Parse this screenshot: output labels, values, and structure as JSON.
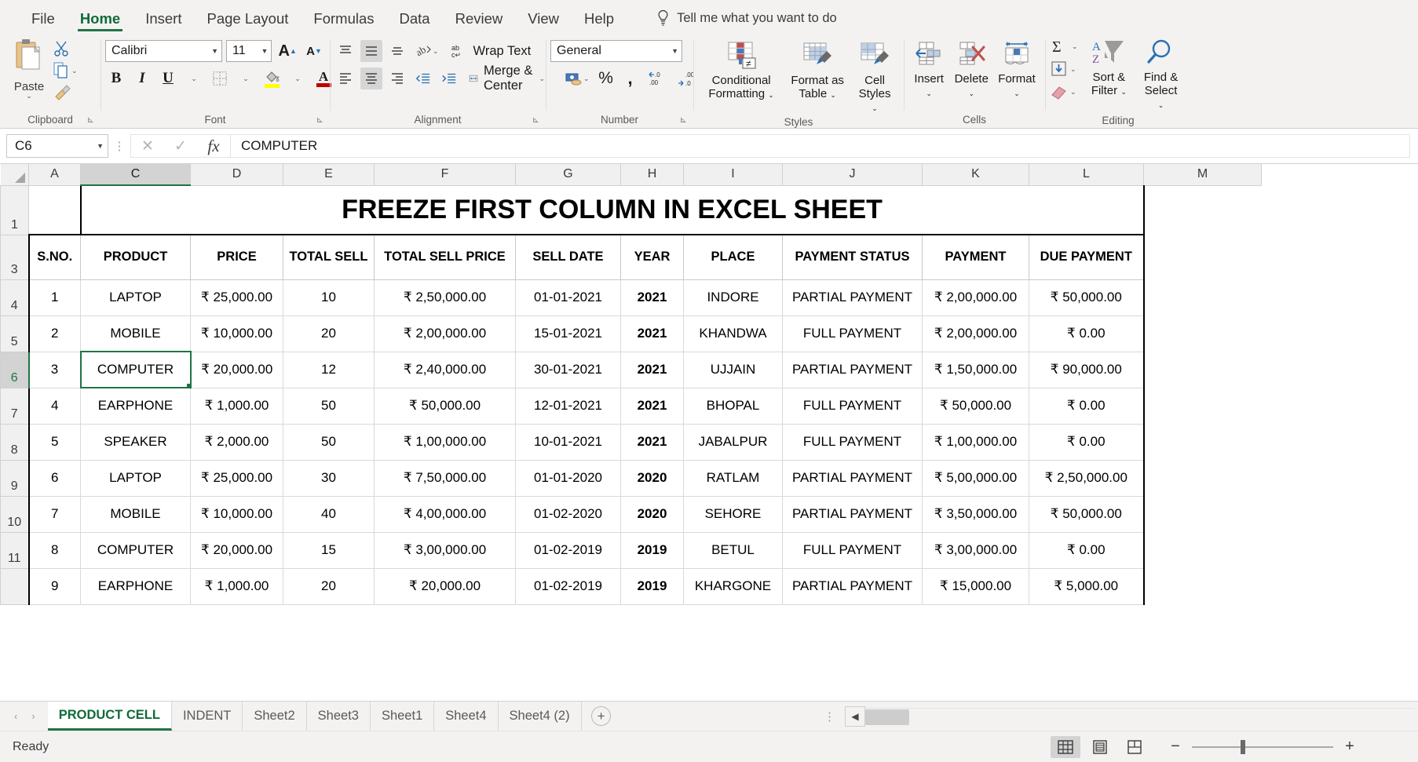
{
  "app": {
    "name": "Microsoft Excel",
    "status_text": "Ready"
  },
  "ribbon": {
    "tabs": [
      {
        "label": "File",
        "active": false
      },
      {
        "label": "Home",
        "active": true
      },
      {
        "label": "Insert",
        "active": false
      },
      {
        "label": "Page Layout",
        "active": false
      },
      {
        "label": "Formulas",
        "active": false
      },
      {
        "label": "Data",
        "active": false
      },
      {
        "label": "Review",
        "active": false
      },
      {
        "label": "View",
        "active": false
      },
      {
        "label": "Help",
        "active": false
      }
    ],
    "tell_me": "Tell me what you want to do",
    "groups": {
      "clipboard": {
        "label": "Clipboard",
        "paste_label": "Paste",
        "cut_label": "Cut",
        "copy_label": "Copy",
        "format_painter_label": "Format Painter"
      },
      "font": {
        "label": "Font",
        "font_name": "Calibri",
        "font_size": "11",
        "grow_font": "A",
        "shrink_font": "A",
        "bold": "B",
        "italic": "I",
        "underline": "U",
        "borders_label": "Borders",
        "fill_color_label": "Fill Color",
        "font_color_label": "Font Color"
      },
      "alignment": {
        "label": "Alignment",
        "wrap_text": "Wrap Text",
        "merge_center": "Merge & Center",
        "orientation_label": "Orientation",
        "decrease_indent": "Decrease Indent",
        "increase_indent": "Increase Indent"
      },
      "number": {
        "label": "Number",
        "format": "General",
        "accounting_label": "Accounting Number Format",
        "percent": "%",
        "comma": ",",
        "increase_decimal": ".00",
        "decrease_decimal": ".00"
      },
      "styles": {
        "label": "Styles",
        "conditional_formatting": "Conditional Formatting",
        "format_as_table": "Format as Table",
        "cell_styles": "Cell Styles"
      },
      "cells": {
        "label": "Cells",
        "insert": "Insert",
        "delete": "Delete",
        "format": "Format"
      },
      "editing": {
        "label": "Editing",
        "autosum": "AutoSum",
        "fill": "Fill",
        "clear": "Clear",
        "sort_filter": "Sort & Filter",
        "find_select": "Find & Select"
      }
    }
  },
  "formula_bar": {
    "name_box": "C6",
    "cancel": "✕",
    "enter": "✓",
    "insert_function": "fx",
    "content": "COMPUTER"
  },
  "grid": {
    "columns": [
      "A",
      "C",
      "D",
      "E",
      "F",
      "G",
      "H",
      "I",
      "J",
      "K",
      "L",
      "M"
    ],
    "selected_column": "C",
    "rows": [
      "1",
      "3",
      "4",
      "5",
      "6",
      "7",
      "8",
      "9",
      "10",
      "11"
    ],
    "selected_row": "6",
    "active_cell": "C6",
    "title": "FREEZE FIRST COLUMN IN EXCEL SHEET",
    "headers": [
      "S.NO.",
      "PRODUCT",
      "PRICE",
      "TOTAL SELL",
      "TOTAL SELL PRICE",
      "SELL DATE",
      "YEAR",
      "PLACE",
      "PAYMENT STATUS",
      "PAYMENT",
      "DUE PAYMENT"
    ],
    "data": [
      [
        "1",
        "LAPTOP",
        "₹ 25,000.00",
        "10",
        "₹ 2,50,000.00",
        "01-01-2021",
        "2021",
        "INDORE",
        "PARTIAL PAYMENT",
        "₹ 2,00,000.00",
        "₹ 50,000.00"
      ],
      [
        "2",
        "MOBILE",
        "₹ 10,000.00",
        "20",
        "₹ 2,00,000.00",
        "15-01-2021",
        "2021",
        "KHANDWA",
        "FULL PAYMENT",
        "₹ 2,00,000.00",
        "₹ 0.00"
      ],
      [
        "3",
        "COMPUTER",
        "₹ 20,000.00",
        "12",
        "₹ 2,40,000.00",
        "30-01-2021",
        "2021",
        "UJJAIN",
        "PARTIAL PAYMENT",
        "₹ 1,50,000.00",
        "₹ 90,000.00"
      ],
      [
        "4",
        "EARPHONE",
        "₹ 1,000.00",
        "50",
        "₹ 50,000.00",
        "12-01-2021",
        "2021",
        "BHOPAL",
        "FULL PAYMENT",
        "₹ 50,000.00",
        "₹ 0.00"
      ],
      [
        "5",
        "SPEAKER",
        "₹ 2,000.00",
        "50",
        "₹ 1,00,000.00",
        "10-01-2021",
        "2021",
        "JABALPUR",
        "FULL PAYMENT",
        "₹ 1,00,000.00",
        "₹ 0.00"
      ],
      [
        "6",
        "LAPTOP",
        "₹ 25,000.00",
        "30",
        "₹ 7,50,000.00",
        "01-01-2020",
        "2020",
        "RATLAM",
        "PARTIAL PAYMENT",
        "₹ 5,00,000.00",
        "₹ 2,50,000.00"
      ],
      [
        "7",
        "MOBILE",
        "₹ 10,000.00",
        "40",
        "₹ 4,00,000.00",
        "01-02-2020",
        "2020",
        "SEHORE",
        "PARTIAL PAYMENT",
        "₹ 3,50,000.00",
        "₹ 50,000.00"
      ],
      [
        "8",
        "COMPUTER",
        "₹ 20,000.00",
        "15",
        "₹ 3,00,000.00",
        "01-02-2019",
        "2019",
        "BETUL",
        "FULL PAYMENT",
        "₹ 3,00,000.00",
        "₹ 0.00"
      ],
      [
        "9",
        "EARPHONE",
        "₹ 1,000.00",
        "20",
        "₹ 20,000.00",
        "01-02-2019",
        "2019",
        "KHARGONE",
        "PARTIAL PAYMENT",
        "₹ 15,000.00",
        "₹ 5,000.00"
      ]
    ]
  },
  "sheet_tabs": {
    "tabs": [
      {
        "label": "PRODUCT CELL",
        "active": true
      },
      {
        "label": "INDENT",
        "active": false
      },
      {
        "label": "Sheet2",
        "active": false
      },
      {
        "label": "Sheet3",
        "active": false
      },
      {
        "label": "Sheet1",
        "active": false
      },
      {
        "label": "Sheet4",
        "active": false
      },
      {
        "label": "Sheet4 (2)",
        "active": false
      }
    ],
    "add_sheet": "+",
    "prev": "‹",
    "next": "›"
  },
  "status_bar": {
    "ready": "Ready",
    "views": [
      {
        "name": "normal-view",
        "active": true
      },
      {
        "name": "page-layout-view",
        "active": false
      },
      {
        "name": "page-break-preview",
        "active": false
      }
    ],
    "zoom_out": "−",
    "zoom_in": "+",
    "zoom_level": ""
  },
  "colors": {
    "accent_green": "#217346",
    "ribbon_bg": "#f3f2f1",
    "grid_line": "#d9d9d9",
    "header_bg": "#f0f0f0"
  }
}
